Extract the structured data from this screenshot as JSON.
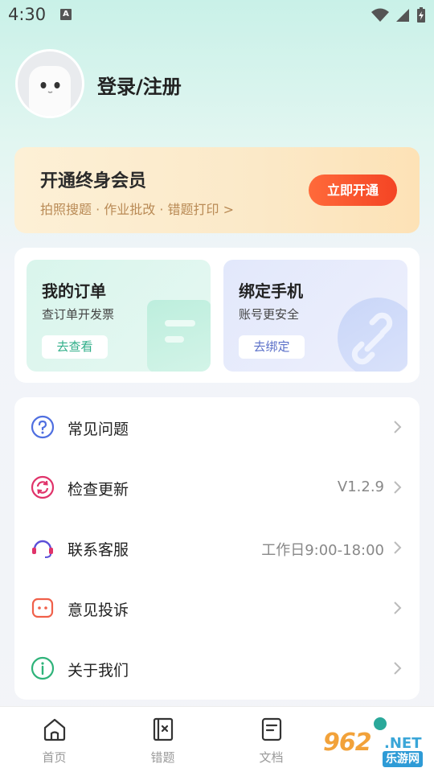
{
  "status_bar": {
    "time": "4:30",
    "notification_badge": "A"
  },
  "profile": {
    "login_text": "登录/注册"
  },
  "vip_banner": {
    "title": "开通终身会员",
    "subtitle": "拍照搜题 · 作业批改 · 错题打印 >",
    "button_label": "立即开通"
  },
  "quick_cards": [
    {
      "title": "我的订单",
      "subtitle": "查订单开发票",
      "button_label": "去查看"
    },
    {
      "title": "绑定手机",
      "subtitle": "账号更安全",
      "button_label": "去绑定"
    }
  ],
  "menu": [
    {
      "label": "常见问题",
      "value": "",
      "icon": "question-icon",
      "color": "#4f6fe0"
    },
    {
      "label": "检查更新",
      "value": "V1.2.9",
      "icon": "refresh-icon",
      "color": "#e0336a"
    },
    {
      "label": "联系客服",
      "value": "工作日9:00-18:00",
      "icon": "headset-icon",
      "color": "#5b4fd8"
    },
    {
      "label": "意见投诉",
      "value": "",
      "icon": "chat-icon",
      "color": "#f0604a"
    },
    {
      "label": "关于我们",
      "value": "",
      "icon": "info-icon",
      "color": "#2fb37a"
    }
  ],
  "bottom_nav": [
    {
      "label": "首页",
      "icon": "home-icon"
    },
    {
      "label": "错题",
      "icon": "mistakes-icon"
    },
    {
      "label": "文档",
      "icon": "document-icon"
    },
    {
      "label": "",
      "icon": "profile-icon"
    }
  ],
  "watermark": {
    "number": "962",
    "suffix": ".NET",
    "site_name": "乐游网"
  },
  "colors": {
    "accent_green": "#2fae88",
    "vip_button": "#f44424",
    "vip_subtitle": "#b98a55"
  }
}
